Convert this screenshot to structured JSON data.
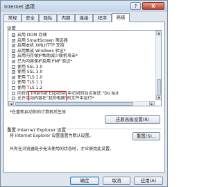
{
  "window": {
    "title": "Internet 选项",
    "help_label": "?",
    "close_label": "X"
  },
  "tabs": [
    {
      "label": "常规",
      "active": false
    },
    {
      "label": "安全",
      "active": false
    },
    {
      "label": "隐私",
      "active": false
    },
    {
      "label": "内容",
      "active": false
    },
    {
      "label": "连接",
      "active": false
    },
    {
      "label": "程序",
      "active": false
    },
    {
      "label": "高级",
      "active": true
    }
  ],
  "settings": {
    "label": "设置",
    "rows": [
      {
        "text": "启用 DOM 存储",
        "checked": true
      },
      {
        "text": "启用 SmartScreen 筛选器",
        "checked": true
      },
      {
        "text": "启用本机 XMLHTTP 支持",
        "checked": true
      },
      {
        "text": "启用集成 Windows 验证*",
        "checked": true
      },
      {
        "text": "启用内存保护帮助减少联机攻击*",
        "checked": true
      },
      {
        "text": "已为内容保护启用 PMP 验证*",
        "checked": true
      },
      {
        "text": "使用 SSL 2.0",
        "checked": false
      },
      {
        "text": "使用 SSL 3.0",
        "checked": true
      },
      {
        "text": "使用 TLS 1.0",
        "checked": true
      },
      {
        "text": "使用 TLS 1.1",
        "checked": false
      },
      {
        "text": "使用 TLS 1.2",
        "checked": false
      },
      {
        "text": "向仅在 Internet Explorer 中访问的站点发送 \"Do Not",
        "checked": false
      },
      {
        "text": "允许活动内容在\"我的电脑\"的文件中运行*",
        "checked": false
      }
    ]
  },
  "note": "*在重新启动你的计算机后生效",
  "restore_advanced_label": "还原高级设置(R)",
  "reset": {
    "group_title": "重置 Internet Explorer 设置",
    "description": "将 Internet Explorer 设置重置为默认设置。",
    "button_label": "重置(S)...",
    "warning": "只有在浏览器处于无法使用的状态时，才应使用此设置。"
  },
  "footer": {
    "ok_label": "确定",
    "cancel_label": "取消",
    "apply_label": "应用(A)"
  }
}
